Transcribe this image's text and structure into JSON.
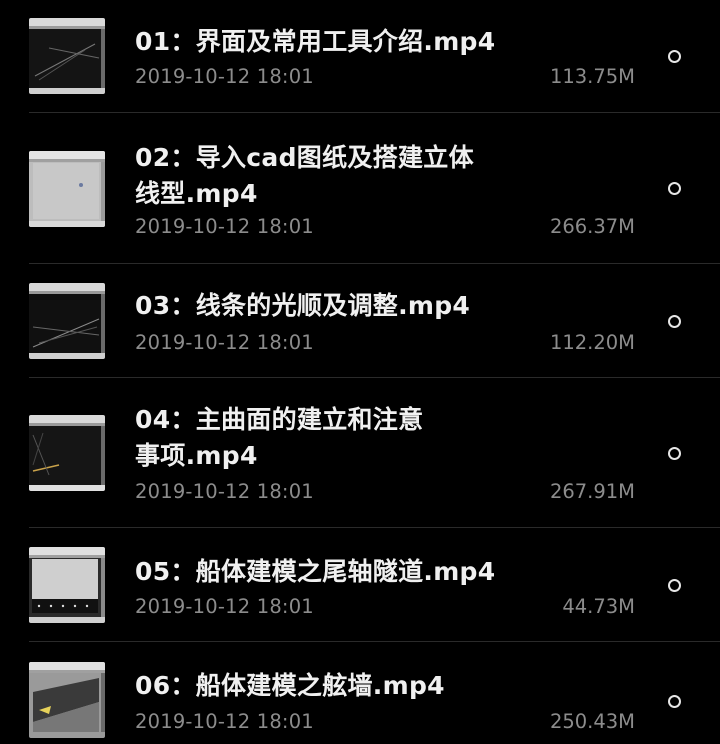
{
  "files": [
    {
      "title": "01：界面及常用工具介绍.mp4",
      "date": "2019-10-12 18:01",
      "size": "113.75M",
      "thumb_theme": "dark"
    },
    {
      "title": "02：导入cad图纸及搭建立体线型.mp4",
      "title_lines": [
        "02：导入cad图纸及搭建立体",
        "线型.mp4"
      ],
      "date": "2019-10-12 18:01",
      "size": "266.37M",
      "thumb_theme": "light"
    },
    {
      "title": "03：线条的光顺及调整.mp4",
      "date": "2019-10-12 18:01",
      "size": "112.20M",
      "thumb_theme": "dark"
    },
    {
      "title": "04：主曲面的建立和注意事项.mp4",
      "title_lines": [
        "04：主曲面的建立和注意",
        "事项.mp4"
      ],
      "date": "2019-10-12 18:01",
      "size": "267.91M",
      "thumb_theme": "dark"
    },
    {
      "title": "05：船体建模之尾轴隧道.mp4",
      "date": "2019-10-12 18:01",
      "size": "44.73M",
      "thumb_theme": "light"
    },
    {
      "title": "06：船体建模之舷墙.mp4",
      "date": "2019-10-12 18:01",
      "size": "250.43M",
      "thumb_theme": "dark"
    }
  ],
  "colors": {
    "background": "#000000",
    "title_text": "#f0f0f0",
    "meta_text": "#8c8c8c",
    "separator": "#2a2a2a",
    "radio_border": "#e6e6e6"
  },
  "icons": {
    "select": "radio-circle-icon"
  }
}
